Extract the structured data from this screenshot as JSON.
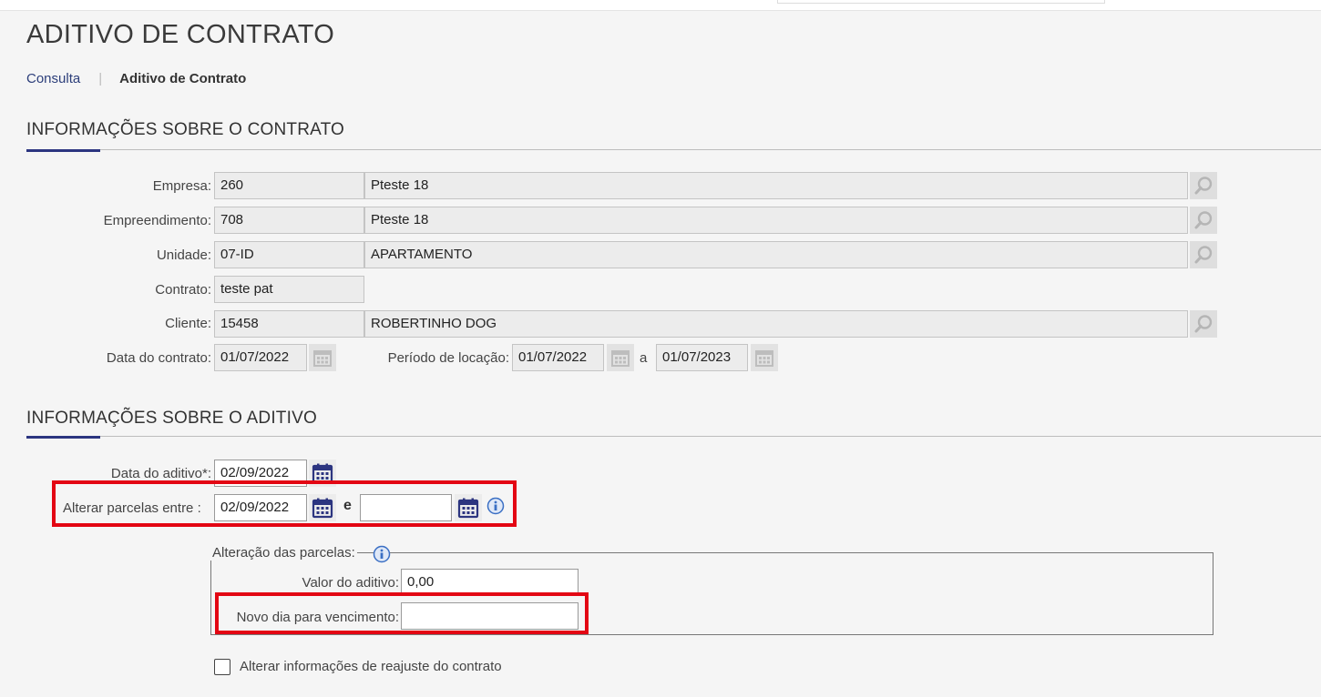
{
  "page": {
    "title": "ADITIVO DE CONTRATO"
  },
  "breadcrumb": {
    "link": "Consulta",
    "separator": "|",
    "current": "Aditivo de Contrato"
  },
  "contract_section": {
    "title": "INFORMAÇÕES SOBRE O CONTRATO",
    "empresa": {
      "label": "Empresa:",
      "code": "260",
      "name": "Pteste 18"
    },
    "empreendimento": {
      "label": "Empreendimento:",
      "code": "708",
      "name": "Pteste 18"
    },
    "unidade": {
      "label": "Unidade:",
      "code": "07-ID",
      "name": "APARTAMENTO"
    },
    "contrato": {
      "label": "Contrato:",
      "value": "teste pat"
    },
    "cliente": {
      "label": "Cliente:",
      "code": "15458",
      "name": "ROBERTINHO DOG"
    },
    "data_contrato": {
      "label": "Data do contrato:",
      "value": "01/07/2022"
    },
    "periodo_locacao": {
      "label": "Período de locação:",
      "start": "01/07/2022",
      "separator": "a",
      "end": "01/07/2023"
    }
  },
  "aditivo_section": {
    "title": "INFORMAÇÕES SOBRE O ADITIVO",
    "data_aditivo": {
      "label": "Data do aditivo*:",
      "value": "02/09/2022"
    },
    "alterar_parcelas": {
      "label": "Alterar parcelas entre :",
      "start": "02/09/2022",
      "separator": "e",
      "end": ""
    },
    "alteracao_parcelas": {
      "legend": "Alteração das parcelas:",
      "valor_aditivo": {
        "label": "Valor do aditivo:",
        "value": "0,00"
      },
      "novo_dia": {
        "label": "Novo dia para vencimento:",
        "value": ""
      }
    },
    "reajuste_checkbox": {
      "label": "Alterar informações de reajuste do contrato",
      "checked": false
    }
  },
  "icons": {
    "search": "search-icon",
    "calendar": "calendar-icon",
    "info": "info-icon"
  },
  "colors": {
    "accent": "#2c3580",
    "highlight": "#e30613",
    "link": "#2c3e7a"
  }
}
